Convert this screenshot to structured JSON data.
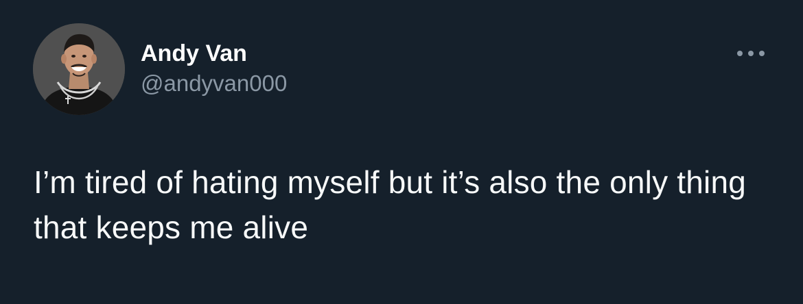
{
  "tweet": {
    "author": {
      "display_name": "Andy Van",
      "handle": "@andyvan000",
      "avatar_icon": "profile-photo"
    },
    "more_icon": "more-horizontal-icon",
    "text": "I’m tired of hating myself but it’s also the only thing that keeps me alive"
  },
  "colors": {
    "background": "#15202b",
    "text_primary": "#ffffff",
    "text_secondary": "#8b98a5"
  }
}
